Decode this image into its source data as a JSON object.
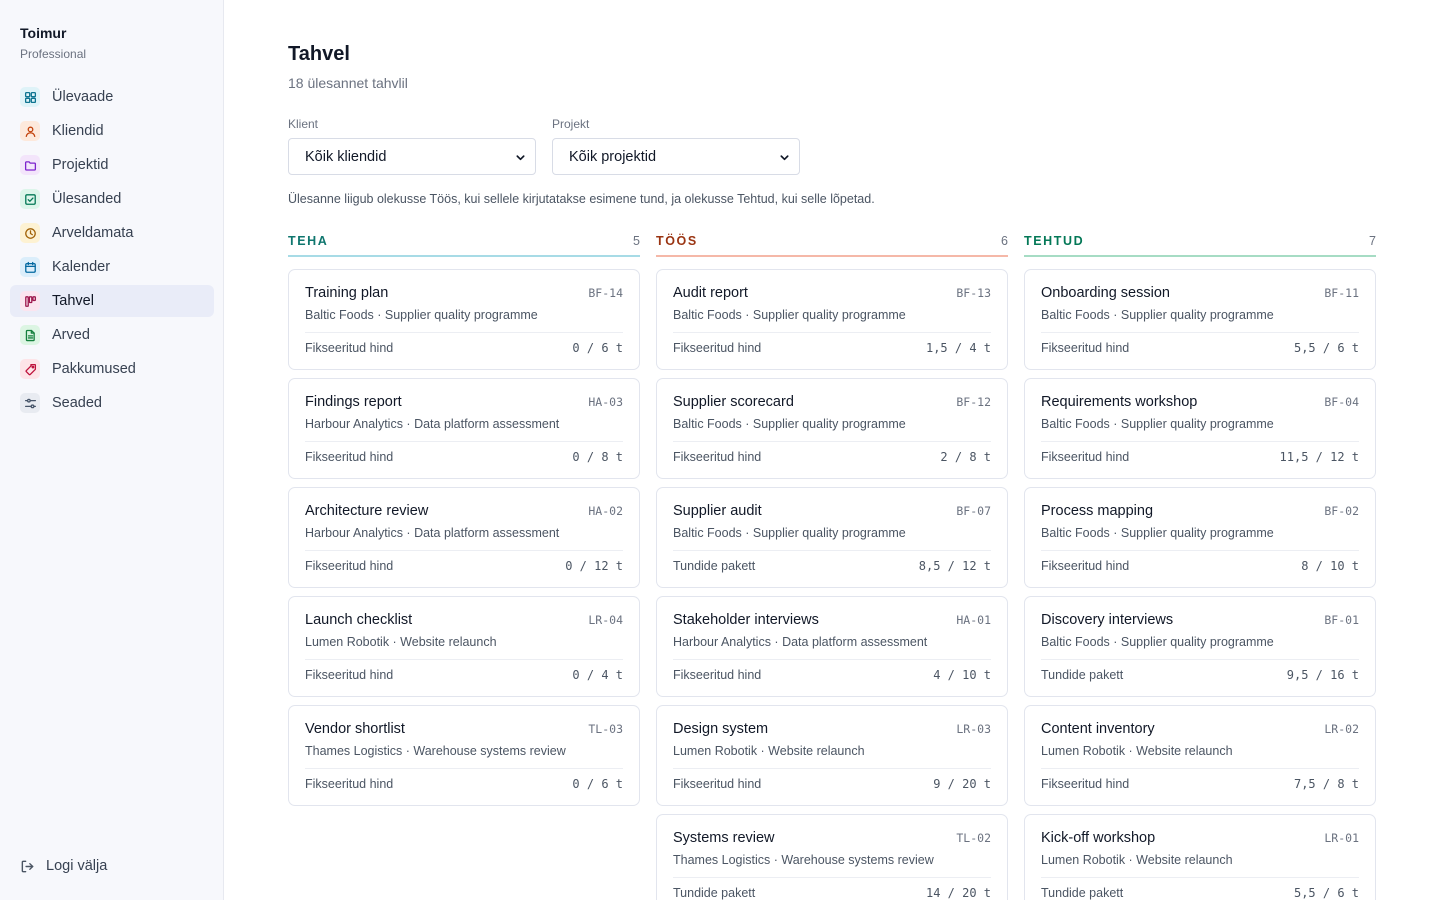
{
  "brand": {
    "name": "Toimur",
    "plan": "Professional"
  },
  "sidebar": {
    "items": [
      {
        "label": "Ülevaade",
        "icon": "grid-icon",
        "color": "#0e7490",
        "bg": "#dff3f8"
      },
      {
        "label": "Kliendid",
        "icon": "user-icon",
        "color": "#c2410c",
        "bg": "#fde9dc"
      },
      {
        "label": "Projektid",
        "icon": "folder-icon",
        "color": "#7e22ce",
        "bg": "#f3e5fb"
      },
      {
        "label": "Ülesanded",
        "icon": "checkbox-icon",
        "color": "#047857",
        "bg": "#dcf5ea"
      },
      {
        "label": "Arveldamata",
        "icon": "clock-icon",
        "color": "#a16207",
        "bg": "#fdf2d3"
      },
      {
        "label": "Kalender",
        "icon": "calendar-icon",
        "color": "#0369a1",
        "bg": "#dbeefb"
      },
      {
        "label": "Tahvel",
        "icon": "kanban-icon",
        "color": "#9d174d",
        "bg": "#fbe4ef",
        "active": true
      },
      {
        "label": "Arved",
        "icon": "document-icon",
        "color": "#15803d",
        "bg": "#dcf5e3"
      },
      {
        "label": "Pakkumused",
        "icon": "tag-icon",
        "color": "#be123c",
        "bg": "#fde4e8"
      },
      {
        "label": "Seaded",
        "icon": "sliders-icon",
        "color": "#475569",
        "bg": "#e8ebf1"
      }
    ],
    "logout": "Logi välja"
  },
  "page": {
    "title": "Tahvel",
    "subtitle": "18 ülesannet tahvlil",
    "filters": {
      "client_label": "Klient",
      "client_value": "Kõik kliendid",
      "project_label": "Projekt",
      "project_value": "Kõik projektid"
    },
    "hint": "Ülesanne liigub olekusse Töös, kui sellele kirjutatakse esimene tund, ja olekusse Tehtud, kui selle lõpetad."
  },
  "columns": [
    {
      "title": "TEHA",
      "count": "5",
      "color": "#0f766e",
      "line": "#a7dbe6",
      "cards": [
        {
          "title": "Training plan",
          "code": "BF-14",
          "sub": "Baltic Foods · Supplier quality programme",
          "type": "Fikseeritud hind",
          "hours": "0 / 6 t"
        },
        {
          "title": "Findings report",
          "code": "HA-03",
          "sub": "Harbour Analytics · Data platform assessment",
          "type": "Fikseeritud hind",
          "hours": "0 / 8 t"
        },
        {
          "title": "Architecture review",
          "code": "HA-02",
          "sub": "Harbour Analytics · Data platform assessment",
          "type": "Fikseeritud hind",
          "hours": "0 / 12 t"
        },
        {
          "title": "Launch checklist",
          "code": "LR-04",
          "sub": "Lumen Robotik · Website relaunch",
          "type": "Fikseeritud hind",
          "hours": "0 / 4 t"
        },
        {
          "title": "Vendor shortlist",
          "code": "TL-03",
          "sub": "Thames Logistics · Warehouse systems review",
          "type": "Fikseeritud hind",
          "hours": "0 / 6 t"
        }
      ]
    },
    {
      "title": "TÖÖS",
      "count": "6",
      "color": "#9a3412",
      "line": "#f5b8a8",
      "cards": [
        {
          "title": "Audit report",
          "code": "BF-13",
          "sub": "Baltic Foods · Supplier quality programme",
          "type": "Fikseeritud hind",
          "hours": "1,5 / 4 t"
        },
        {
          "title": "Supplier scorecard",
          "code": "BF-12",
          "sub": "Baltic Foods · Supplier quality programme",
          "type": "Fikseeritud hind",
          "hours": "2 / 8 t"
        },
        {
          "title": "Supplier audit",
          "code": "BF-07",
          "sub": "Baltic Foods · Supplier quality programme",
          "type": "Tundide pakett",
          "hours": "8,5 / 12 t"
        },
        {
          "title": "Stakeholder interviews",
          "code": "HA-01",
          "sub": "Harbour Analytics · Data platform assessment",
          "type": "Fikseeritud hind",
          "hours": "4 / 10 t"
        },
        {
          "title": "Design system",
          "code": "LR-03",
          "sub": "Lumen Robotik · Website relaunch",
          "type": "Fikseeritud hind",
          "hours": "9 / 20 t"
        },
        {
          "title": "Systems review",
          "code": "TL-02",
          "sub": "Thames Logistics · Warehouse systems review",
          "type": "Tundide pakett",
          "hours": "14 / 20 t"
        }
      ]
    },
    {
      "title": "TEHTUD",
      "count": "7",
      "color": "#047857",
      "line": "#a6dcc4",
      "cards": [
        {
          "title": "Onboarding session",
          "code": "BF-11",
          "sub": "Baltic Foods · Supplier quality programme",
          "type": "Fikseeritud hind",
          "hours": "5,5 / 6 t"
        },
        {
          "title": "Requirements workshop",
          "code": "BF-04",
          "sub": "Baltic Foods · Supplier quality programme",
          "type": "Fikseeritud hind",
          "hours": "11,5 / 12 t"
        },
        {
          "title": "Process mapping",
          "code": "BF-02",
          "sub": "Baltic Foods · Supplier quality programme",
          "type": "Fikseeritud hind",
          "hours": "8 / 10 t"
        },
        {
          "title": "Discovery interviews",
          "code": "BF-01",
          "sub": "Baltic Foods · Supplier quality programme",
          "type": "Tundide pakett",
          "hours": "9,5 / 16 t"
        },
        {
          "title": "Content inventory",
          "code": "LR-02",
          "sub": "Lumen Robotik · Website relaunch",
          "type": "Fikseeritud hind",
          "hours": "7,5 / 8 t"
        },
        {
          "title": "Kick-off workshop",
          "code": "LR-01",
          "sub": "Lumen Robotik · Website relaunch",
          "type": "Tundide pakett",
          "hours": "5,5 / 6 t"
        }
      ]
    }
  ]
}
